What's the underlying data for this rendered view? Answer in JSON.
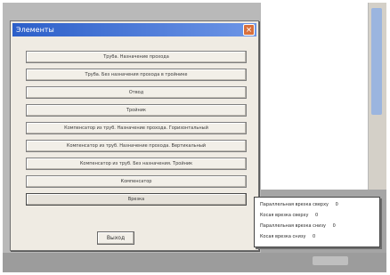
{
  "window": {
    "title": "Элементы",
    "close_glyph": "×"
  },
  "buttons": [
    "Труба. Назначение прохода",
    "Труба. Без назначения прохода в тройнике",
    "Отвод",
    "Тройник",
    "Компенсатор из труб. Назначение прохода. Горизонтальный",
    "Компенсатор из труб. Назначение прохода. Вертикальный",
    "Компенсатор из труб. Без назначения. Тройник",
    "Компенсатор",
    "Врезка"
  ],
  "exit_label": "Выход",
  "popup_menu": {
    "items": [
      {
        "label": "Параллельная врезка сверху",
        "value": "0"
      },
      {
        "label": "Косая врезка сверху",
        "value": "0"
      },
      {
        "label": "Параллельная врезка снизу",
        "value": "0"
      },
      {
        "label": "Косая врезка снизу",
        "value": "0"
      }
    ]
  },
  "colors": {
    "titlebar_start": "#2c5fc9",
    "titlebar_end": "#6d95e6",
    "close_button": "#d9703c",
    "dialog_face": "#efebe3"
  }
}
